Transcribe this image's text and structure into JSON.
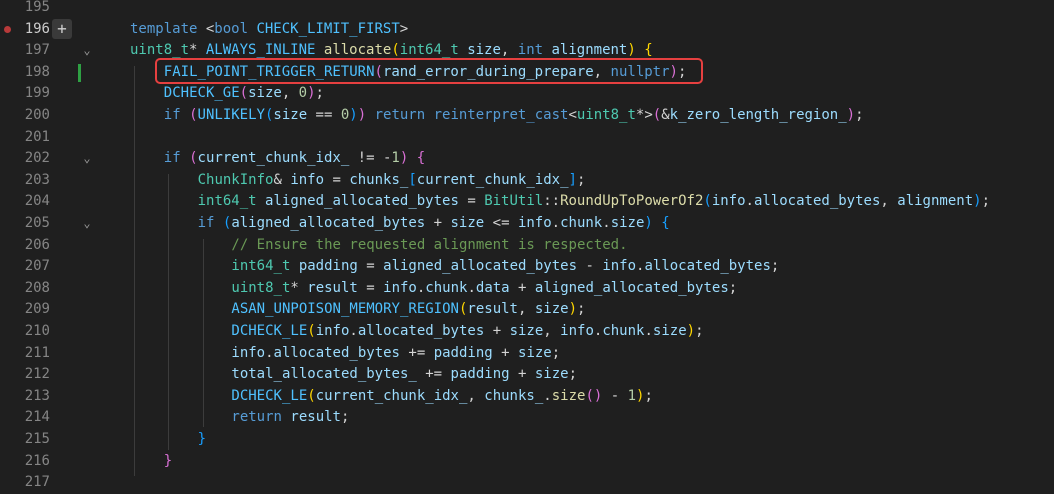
{
  "lines": [
    {
      "n": "195",
      "tokens": []
    },
    {
      "n": "196",
      "tokens": [
        [
          "kw",
          "template "
        ],
        [
          "op",
          "<"
        ],
        [
          "kw",
          "bool "
        ],
        [
          "mc",
          "CHECK_LIMIT_FIRST"
        ],
        [
          "op",
          ">"
        ]
      ]
    },
    {
      "n": "197",
      "tokens": [
        [
          "ty",
          "uint8_t"
        ],
        [
          "op",
          "* "
        ],
        [
          "mc",
          "ALWAYS_INLINE "
        ],
        [
          "fn",
          "allocate"
        ],
        [
          "br1",
          "("
        ],
        [
          "ty",
          "int64_t "
        ],
        [
          "vr",
          "size"
        ],
        [
          "op",
          ", "
        ],
        [
          "kw",
          "int "
        ],
        [
          "vr",
          "alignment"
        ],
        [
          "br1",
          ")"
        ],
        [
          "op",
          " "
        ],
        [
          "br1",
          "{"
        ]
      ]
    },
    {
      "n": "198",
      "tokens": [
        [
          "mc",
          "FAIL_POINT_TRIGGER_RETURN"
        ],
        [
          "br2",
          "("
        ],
        [
          "vr",
          "rand_error_during_prepare"
        ],
        [
          "op",
          ", "
        ],
        [
          "kw",
          "nullptr"
        ],
        [
          "br2",
          ")"
        ],
        [
          "op",
          ";"
        ]
      ]
    },
    {
      "n": "199",
      "tokens": [
        [
          "mc",
          "DCHECK_GE"
        ],
        [
          "br2",
          "("
        ],
        [
          "vr",
          "size"
        ],
        [
          "op",
          ", "
        ],
        [
          "nm",
          "0"
        ],
        [
          "br2",
          ")"
        ],
        [
          "op",
          ";"
        ]
      ]
    },
    {
      "n": "200",
      "tokens": [
        [
          "kw",
          "if "
        ],
        [
          "br2",
          "("
        ],
        [
          "mc",
          "UNLIKELY"
        ],
        [
          "br3",
          "("
        ],
        [
          "vr",
          "size"
        ],
        [
          "op",
          " == "
        ],
        [
          "nm",
          "0"
        ],
        [
          "br3",
          ")"
        ],
        [
          "br2",
          ")"
        ],
        [
          "kw",
          " return "
        ],
        [
          "kw",
          "reinterpret_cast"
        ],
        [
          "op",
          "<"
        ],
        [
          "ty",
          "uint8_t"
        ],
        [
          "op",
          "*>"
        ],
        [
          "br2",
          "("
        ],
        [
          "op",
          "&"
        ],
        [
          "vr",
          "k_zero_length_region_"
        ],
        [
          "br2",
          ")"
        ],
        [
          "op",
          ";"
        ]
      ]
    },
    {
      "n": "201",
      "tokens": []
    },
    {
      "n": "202",
      "tokens": [
        [
          "kw",
          "if "
        ],
        [
          "br2",
          "("
        ],
        [
          "vr",
          "current_chunk_idx_"
        ],
        [
          "op",
          " != "
        ],
        [
          "op",
          "-"
        ],
        [
          "nm",
          "1"
        ],
        [
          "br2",
          ")"
        ],
        [
          "op",
          " "
        ],
        [
          "br2",
          "{"
        ]
      ]
    },
    {
      "n": "203",
      "tokens": [
        [
          "ty",
          "ChunkInfo"
        ],
        [
          "op",
          "& "
        ],
        [
          "vr",
          "info"
        ],
        [
          "op",
          " = "
        ],
        [
          "vr",
          "chunks_"
        ],
        [
          "br3",
          "["
        ],
        [
          "vr",
          "current_chunk_idx_"
        ],
        [
          "br3",
          "]"
        ],
        [
          "op",
          ";"
        ]
      ]
    },
    {
      "n": "204",
      "tokens": [
        [
          "ty",
          "int64_t "
        ],
        [
          "vr",
          "aligned_allocated_bytes"
        ],
        [
          "op",
          " = "
        ],
        [
          "ty",
          "BitUtil"
        ],
        [
          "op",
          "::"
        ],
        [
          "fn",
          "RoundUpToPowerOf2"
        ],
        [
          "br3",
          "("
        ],
        [
          "vr",
          "info"
        ],
        [
          "op",
          "."
        ],
        [
          "vr",
          "allocated_bytes"
        ],
        [
          "op",
          ", "
        ],
        [
          "vr",
          "alignment"
        ],
        [
          "br3",
          ")"
        ],
        [
          "op",
          ";"
        ]
      ]
    },
    {
      "n": "205",
      "tokens": [
        [
          "kw",
          "if "
        ],
        [
          "br3",
          "("
        ],
        [
          "vr",
          "aligned_allocated_bytes"
        ],
        [
          "op",
          " + "
        ],
        [
          "vr",
          "size"
        ],
        [
          "op",
          " <= "
        ],
        [
          "vr",
          "info"
        ],
        [
          "op",
          "."
        ],
        [
          "vr",
          "chunk"
        ],
        [
          "op",
          "."
        ],
        [
          "vr",
          "size"
        ],
        [
          "br3",
          ")"
        ],
        [
          "op",
          " "
        ],
        [
          "br3",
          "{"
        ]
      ]
    },
    {
      "n": "206",
      "tokens": [
        [
          "cm",
          "// Ensure the requested alignment is respected."
        ]
      ]
    },
    {
      "n": "207",
      "tokens": [
        [
          "ty",
          "int64_t "
        ],
        [
          "vr",
          "padding"
        ],
        [
          "op",
          " = "
        ],
        [
          "vr",
          "aligned_allocated_bytes"
        ],
        [
          "op",
          " - "
        ],
        [
          "vr",
          "info"
        ],
        [
          "op",
          "."
        ],
        [
          "vr",
          "allocated_bytes"
        ],
        [
          "op",
          ";"
        ]
      ]
    },
    {
      "n": "208",
      "tokens": [
        [
          "ty",
          "uint8_t"
        ],
        [
          "op",
          "* "
        ],
        [
          "vr",
          "result"
        ],
        [
          "op",
          " = "
        ],
        [
          "vr",
          "info"
        ],
        [
          "op",
          "."
        ],
        [
          "vr",
          "chunk"
        ],
        [
          "op",
          "."
        ],
        [
          "vr",
          "data"
        ],
        [
          "op",
          " + "
        ],
        [
          "vr",
          "aligned_allocated_bytes"
        ],
        [
          "op",
          ";"
        ]
      ]
    },
    {
      "n": "209",
      "tokens": [
        [
          "mc",
          "ASAN_UNPOISON_MEMORY_REGION"
        ],
        [
          "br1",
          "("
        ],
        [
          "vr",
          "result"
        ],
        [
          "op",
          ", "
        ],
        [
          "vr",
          "size"
        ],
        [
          "br1",
          ")"
        ],
        [
          "op",
          ";"
        ]
      ]
    },
    {
      "n": "210",
      "tokens": [
        [
          "mc",
          "DCHECK_LE"
        ],
        [
          "br1",
          "("
        ],
        [
          "vr",
          "info"
        ],
        [
          "op",
          "."
        ],
        [
          "vr",
          "allocated_bytes"
        ],
        [
          "op",
          " + "
        ],
        [
          "vr",
          "size"
        ],
        [
          "op",
          ", "
        ],
        [
          "vr",
          "info"
        ],
        [
          "op",
          "."
        ],
        [
          "vr",
          "chunk"
        ],
        [
          "op",
          "."
        ],
        [
          "vr",
          "size"
        ],
        [
          "br1",
          ")"
        ],
        [
          "op",
          ";"
        ]
      ]
    },
    {
      "n": "211",
      "tokens": [
        [
          "vr",
          "info"
        ],
        [
          "op",
          "."
        ],
        [
          "vr",
          "allocated_bytes"
        ],
        [
          "op",
          " += "
        ],
        [
          "vr",
          "padding"
        ],
        [
          "op",
          " + "
        ],
        [
          "vr",
          "size"
        ],
        [
          "op",
          ";"
        ]
      ]
    },
    {
      "n": "212",
      "tokens": [
        [
          "vr",
          "total_allocated_bytes_"
        ],
        [
          "op",
          " += "
        ],
        [
          "vr",
          "padding"
        ],
        [
          "op",
          " + "
        ],
        [
          "vr",
          "size"
        ],
        [
          "op",
          ";"
        ]
      ]
    },
    {
      "n": "213",
      "tokens": [
        [
          "mc",
          "DCHECK_LE"
        ],
        [
          "br1",
          "("
        ],
        [
          "vr",
          "current_chunk_idx_"
        ],
        [
          "op",
          ", "
        ],
        [
          "vr",
          "chunks_"
        ],
        [
          "op",
          "."
        ],
        [
          "fn",
          "size"
        ],
        [
          "br2",
          "()"
        ],
        [
          "op",
          " - "
        ],
        [
          "nm",
          "1"
        ],
        [
          "br1",
          ")"
        ],
        [
          "op",
          ";"
        ]
      ]
    },
    {
      "n": "214",
      "tokens": [
        [
          "kw",
          "return "
        ],
        [
          "vr",
          "result"
        ],
        [
          "op",
          ";"
        ]
      ]
    },
    {
      "n": "215",
      "tokens": [
        [
          "br3",
          "}"
        ]
      ]
    },
    {
      "n": "216",
      "tokens": [
        [
          "br2",
          "}"
        ]
      ]
    },
    {
      "n": "217",
      "tokens": []
    }
  ],
  "gutter": {
    "plus_label": "+",
    "fold_glyph": "⌄"
  }
}
